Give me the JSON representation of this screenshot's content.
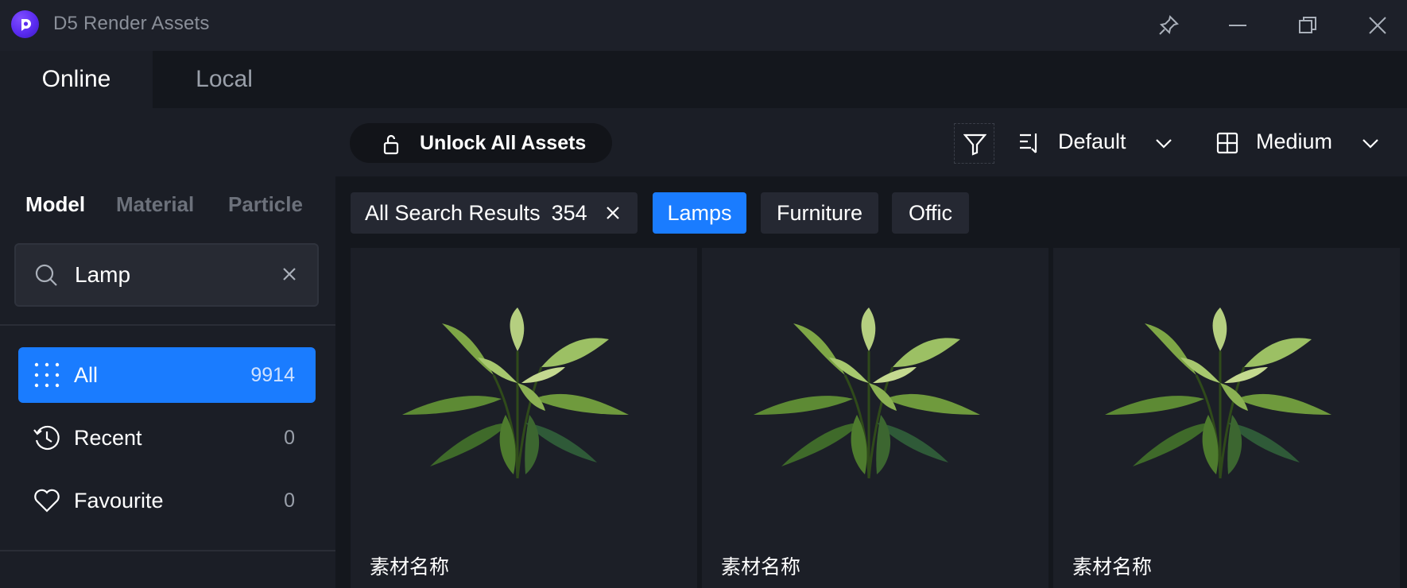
{
  "app": {
    "title": "D5 Render Assets"
  },
  "window_controls": [
    "pin-icon",
    "minimize-icon",
    "restore-icon",
    "close-icon"
  ],
  "top_tabs": [
    {
      "label": "Online",
      "active": true
    },
    {
      "label": "Local",
      "active": false
    }
  ],
  "sidebar": {
    "category_tabs": [
      {
        "label": "Model",
        "active": true
      },
      {
        "label": "Material",
        "active": false
      },
      {
        "label": "Particle",
        "active": false
      }
    ],
    "search": {
      "value": "Lamp",
      "placeholder": ""
    },
    "nav": [
      {
        "label": "All",
        "count": "9914",
        "icon": "grid-dots-icon",
        "active": true
      },
      {
        "label": "Recent",
        "count": "0",
        "icon": "history-icon",
        "active": false
      },
      {
        "label": "Favourite",
        "count": "0",
        "icon": "heart-icon",
        "active": false
      }
    ]
  },
  "toolbar": {
    "unlock_label": "Unlock All Assets",
    "sort_label": "Default",
    "size_label": "Medium"
  },
  "filters": {
    "search_results_label": "All Search Results",
    "search_results_count": "354",
    "chips": [
      {
        "label": "Lamps",
        "active": true
      },
      {
        "label": "Furniture",
        "active": false
      },
      {
        "label": "Offic",
        "active": false
      }
    ]
  },
  "assets": [
    {
      "name": "素材名称"
    },
    {
      "name": "素材名称"
    },
    {
      "name": "素材名称"
    }
  ],
  "colors": {
    "accent": "#1a7cff",
    "background": "#1b1e26",
    "content_bg": "#14171d",
    "card_bg": "#1c1f27"
  }
}
